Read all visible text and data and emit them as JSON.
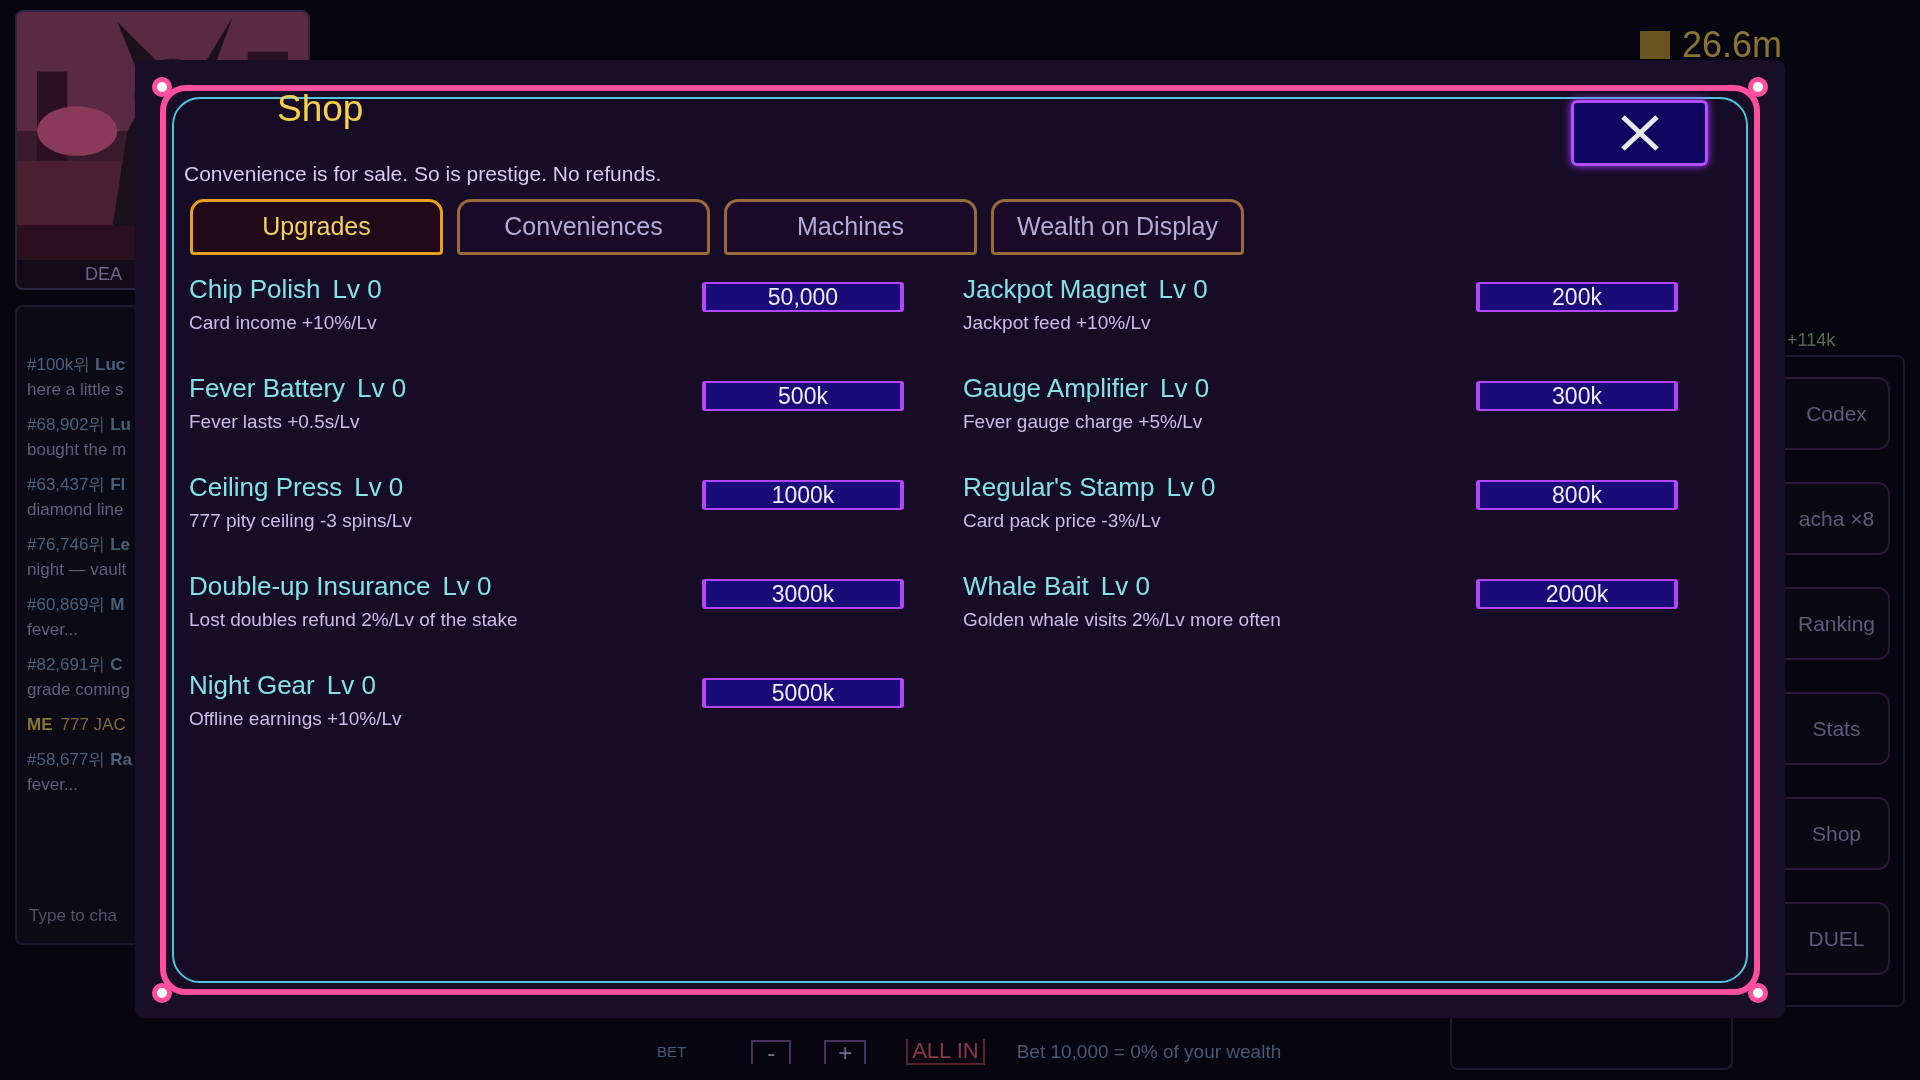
{
  "hud": {
    "wealth": "26.6m",
    "gain": "+114k",
    "portrait_label": "DEA",
    "chat": [
      {
        "kind": "player",
        "head": "#100k위 **Luc**",
        "text": "here a little s"
      },
      {
        "kind": "player",
        "head": "#68,902위 **Lu**",
        "text": "bought the m"
      },
      {
        "kind": "player",
        "head": "#63,437위 **Fl**",
        "text": "diamond line"
      },
      {
        "kind": "player",
        "head": "#76,746위 **Le**",
        "text": "night — vault"
      },
      {
        "kind": "player",
        "head": "#60,869위 **M**",
        "text": "fever..."
      },
      {
        "kind": "player",
        "head": "#82,691위 **C**",
        "text": "grade coming"
      },
      {
        "kind": "me",
        "head": "ME",
        "text": "777 JAC"
      },
      {
        "kind": "player",
        "head": "#58,677위 **Ra**",
        "text": "fever..."
      }
    ],
    "chat_placeholder": "Type to cha",
    "menu": [
      "Codex",
      "acha ×8",
      "Ranking",
      "Stats",
      "Shop",
      "DUEL"
    ],
    "bet_bar": {
      "label": "BET",
      "minus": "-",
      "plus": "+",
      "all_in": "ALL IN",
      "note": "Bet 10,000 = 0% of your wealth"
    }
  },
  "shop": {
    "title": "Shop",
    "subtitle": "Convenience is for sale. So is prestige. No refunds.",
    "tabs": [
      {
        "label": "Upgrades",
        "selected": true
      },
      {
        "label": "Conveniences",
        "selected": false
      },
      {
        "label": "Machines",
        "selected": false
      },
      {
        "label": "Wealth on Display",
        "selected": false
      }
    ],
    "columns": [
      [
        {
          "name": "Chip Polish",
          "level": "Lv 0",
          "desc": "Card income +10%/Lv",
          "price": "50,000"
        },
        {
          "name": "Fever Battery",
          "level": "Lv 0",
          "desc": "Fever lasts +0.5s/Lv",
          "price": "500k"
        },
        {
          "name": "Ceiling Press",
          "level": "Lv 0",
          "desc": "777 pity ceiling -3 spins/Lv",
          "price": "1000k"
        },
        {
          "name": "Double-up Insurance",
          "level": "Lv 0",
          "desc": "Lost doubles refund 2%/Lv of the stake",
          "price": "3000k"
        },
        {
          "name": "Night Gear",
          "level": "Lv 0",
          "desc": "Offline earnings +10%/Lv",
          "price": "5000k"
        }
      ],
      [
        {
          "name": "Jackpot Magnet",
          "level": "Lv 0",
          "desc": "Jackpot feed +10%/Lv",
          "price": "200k"
        },
        {
          "name": "Gauge Amplifier",
          "level": "Lv 0",
          "desc": "Fever gauge charge +5%/Lv",
          "price": "300k"
        },
        {
          "name": "Regular's Stamp",
          "level": "Lv 0",
          "desc": "Card pack price -3%/Lv",
          "price": "800k"
        },
        {
          "name": "Whale Bait",
          "level": "Lv 0",
          "desc": "Golden whale visits 2%/Lv more often",
          "price": "2000k"
        }
      ]
    ]
  }
}
